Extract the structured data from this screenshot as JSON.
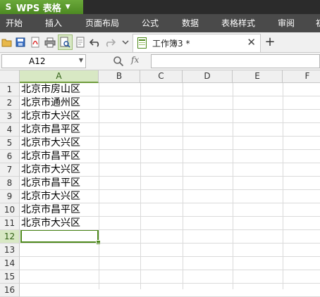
{
  "app": {
    "name": "WPS 表格",
    "logo": "S"
  },
  "menu": [
    "开始",
    "插入",
    "页面布局",
    "公式",
    "数据",
    "表格样式",
    "审阅",
    "初"
  ],
  "toolbar": {
    "icons": [
      "open-folder-icon",
      "save-icon",
      "export-pdf-icon",
      "print-icon",
      "print-preview-icon",
      "print-setup-icon",
      "undo-icon",
      "redo-icon",
      "dropdown-icon"
    ]
  },
  "document_tab": {
    "title": "工作簿3 *",
    "close_glyph": "✕"
  },
  "add_tab_glyph": "+",
  "formula_bar": {
    "name_box": "A12",
    "fx_label": "fx",
    "zoom_glyph": "Q",
    "value": ""
  },
  "columns": [
    "A",
    "B",
    "C",
    "D",
    "E",
    "F"
  ],
  "rows": [
    "1",
    "2",
    "3",
    "4",
    "5",
    "6",
    "7",
    "8",
    "9",
    "10",
    "11",
    "12",
    "13",
    "14",
    "15",
    "16"
  ],
  "cells_A": [
    "北京市房山区",
    "北京市通州区",
    "北京市大兴区",
    "北京市昌平区",
    "北京市大兴区",
    "北京市昌平区",
    "北京市大兴区",
    "北京市昌平区",
    "北京市大兴区",
    "北京市昌平区",
    "北京市大兴区"
  ],
  "selection": {
    "cell": "A12",
    "column": "A",
    "row": "12",
    "accent_color": "#4f8a1d"
  }
}
